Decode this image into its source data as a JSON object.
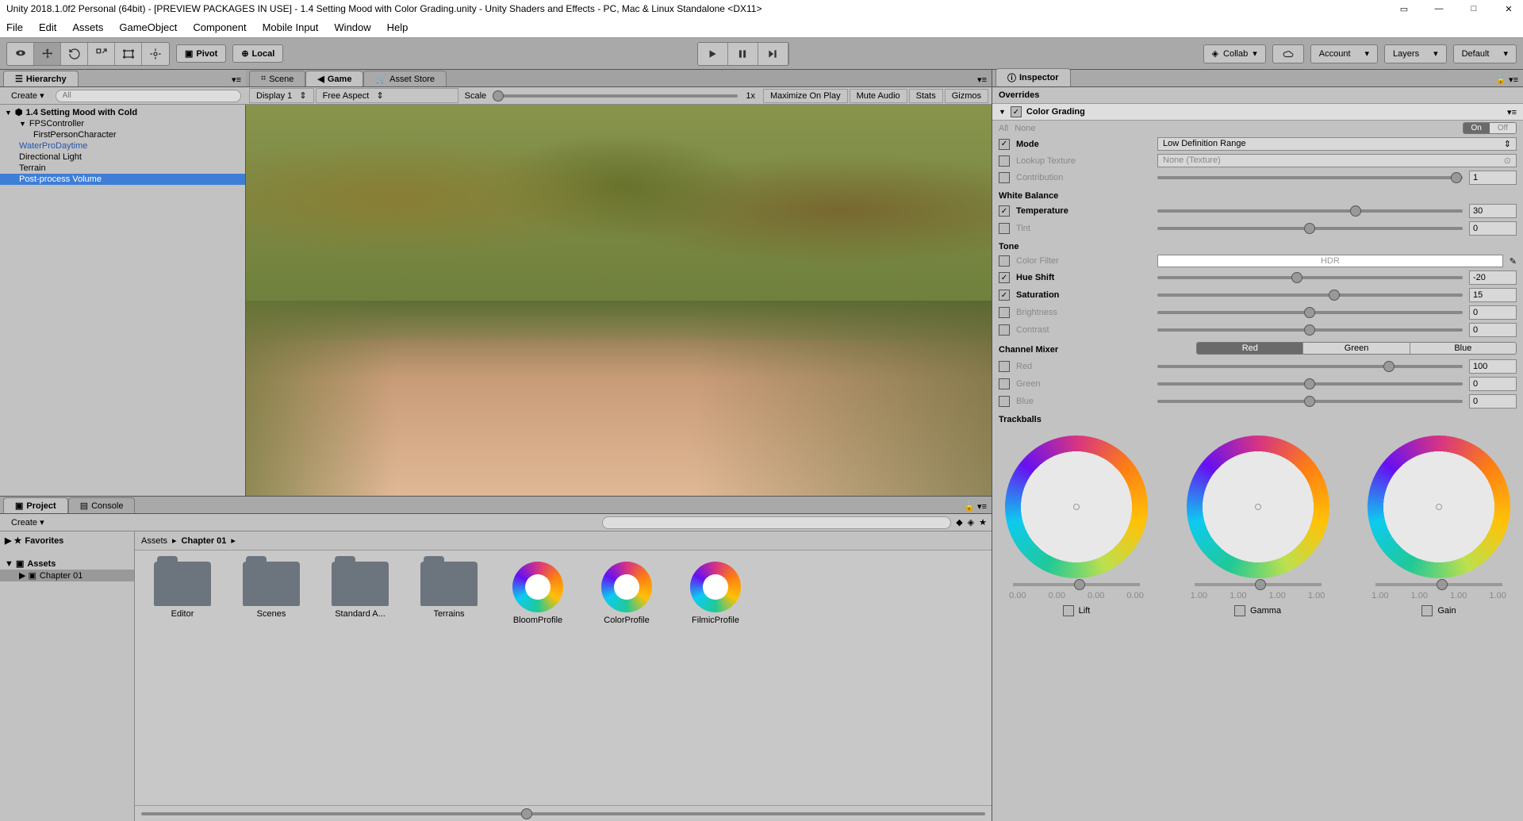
{
  "title": "Unity 2018.1.0f2 Personal (64bit) - [PREVIEW PACKAGES IN USE] - 1.4 Setting Mood with Color Grading.unity - Unity Shaders and Effects - PC, Mac & Linux Standalone <DX11>",
  "menu": [
    "File",
    "Edit",
    "Assets",
    "GameObject",
    "Component",
    "Mobile Input",
    "Window",
    "Help"
  ],
  "toolbar": {
    "pivot": "Pivot",
    "local": "Local",
    "collab": "Collab",
    "account": "Account",
    "layers": "Layers",
    "layout": "Default"
  },
  "hierarchy": {
    "tab": "Hierarchy",
    "create": "Create",
    "search_placeholder": "All",
    "root": "1.4 Setting Mood with Cold",
    "items": [
      {
        "name": "FPSController",
        "toggle": true
      },
      {
        "name": "FirstPersonCharacter",
        "indent": 2
      },
      {
        "name": "WaterProDaytime",
        "blue": true
      },
      {
        "name": "Directional Light"
      },
      {
        "name": "Terrain"
      },
      {
        "name": "Post-process Volume",
        "selected": true
      }
    ]
  },
  "scene": {
    "tabs": [
      "Scene",
      "Game",
      "Asset Store"
    ],
    "active_tab": 1,
    "display": "Display 1",
    "aspect": "Free Aspect",
    "scale": "Scale",
    "scale_val": "1x",
    "maximize": "Maximize On Play",
    "mute": "Mute Audio",
    "stats": "Stats",
    "gizmos": "Gizmos"
  },
  "project": {
    "tabs": [
      "Project",
      "Console"
    ],
    "create": "Create",
    "favorites": "Favorites",
    "assets": "Assets",
    "chapter": "Chapter 01",
    "breadcrumb": [
      "Assets",
      "Chapter 01"
    ],
    "items": [
      {
        "name": "Editor",
        "type": "folder"
      },
      {
        "name": "Scenes",
        "type": "folder"
      },
      {
        "name": "Standard A...",
        "type": "folder"
      },
      {
        "name": "Terrains",
        "type": "folder"
      },
      {
        "name": "BloomProfile",
        "type": "profile"
      },
      {
        "name": "ColorProfile",
        "type": "profile"
      },
      {
        "name": "FilmicProfile",
        "type": "profile"
      }
    ]
  },
  "inspector": {
    "tab": "Inspector",
    "overrides": "Overrides",
    "component": "Color Grading",
    "all": "All",
    "none": "None",
    "on": "On",
    "off": "Off",
    "mode_label": "Mode",
    "mode_value": "Low Definition Range",
    "lookup_label": "Lookup Texture",
    "lookup_value": "None (Texture)",
    "contribution_label": "Contribution",
    "contribution_value": "1",
    "white_balance": "White Balance",
    "temperature_label": "Temperature",
    "temperature_value": "30",
    "tint_label": "Tint",
    "tint_value": "0",
    "tone": "Tone",
    "colorfilter_label": "Color Filter",
    "hdr": "HDR",
    "hueshift_label": "Hue Shift",
    "hueshift_value": "-20",
    "saturation_label": "Saturation",
    "saturation_value": "15",
    "brightness_label": "Brightness",
    "brightness_value": "0",
    "contrast_label": "Contrast",
    "contrast_value": "0",
    "channel_mixer": "Channel Mixer",
    "channels": [
      "Red",
      "Green",
      "Blue"
    ],
    "red_label": "Red",
    "red_value": "100",
    "green_label": "Green",
    "green_value": "0",
    "blue_label": "Blue",
    "blue_value": "0",
    "trackballs": "Trackballs",
    "tb": [
      {
        "label": "Lift",
        "vals": [
          "0.00",
          "0.00",
          "0.00",
          "0.00"
        ]
      },
      {
        "label": "Gamma",
        "vals": [
          "1.00",
          "1.00",
          "1.00",
          "1.00"
        ]
      },
      {
        "label": "Gain",
        "vals": [
          "1.00",
          "1.00",
          "1.00",
          "1.00"
        ]
      }
    ]
  }
}
